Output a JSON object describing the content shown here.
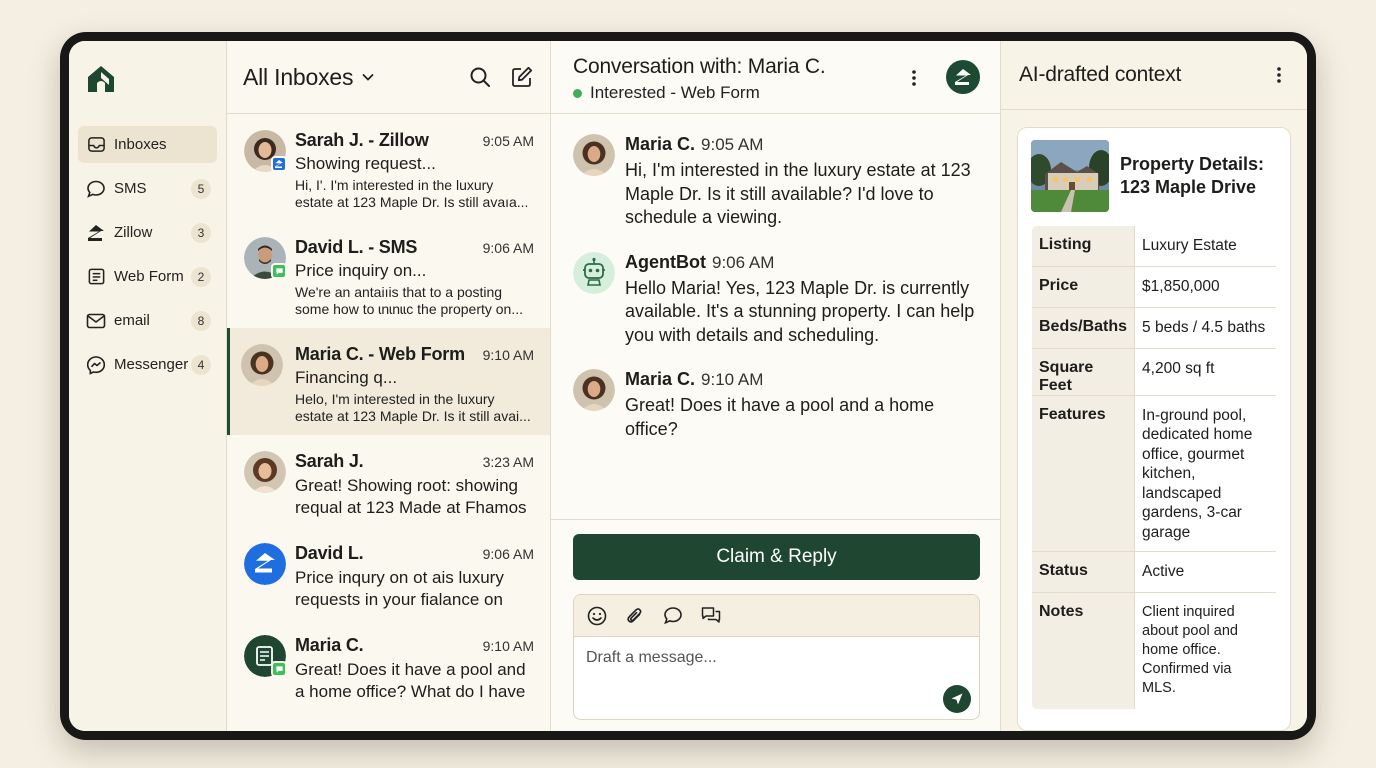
{
  "nav": {
    "items": [
      {
        "label": "Inboxes",
        "icon": "inbox-tray-icon",
        "count": null
      },
      {
        "label": "SMS",
        "icon": "chat-bubble-icon",
        "count": "5"
      },
      {
        "label": "Zillow",
        "icon": "zillow-icon",
        "count": "3"
      },
      {
        "label": "Web Form",
        "icon": "form-icon",
        "count": "2"
      },
      {
        "label": "email",
        "icon": "envelope-icon",
        "count": "8"
      },
      {
        "label": "Messenger",
        "icon": "messenger-icon",
        "count": "4"
      }
    ]
  },
  "inbox": {
    "title": "All Inboxes",
    "messages": [
      {
        "name": "Sarah J. - Zillow",
        "time": "9:05 AM",
        "subject": "Showing request...",
        "preview": "Hi, I'. I'm interested in the luxury estate at  123 Maple Dr. Is still avaıa..."
      },
      {
        "name": "David L. - SMS",
        "time": "9:06 AM",
        "subject": "Price inquiry on...",
        "preview": "We're an antaiıis that to a posting some how to ɩnɩnɩɩc the property on..."
      },
      {
        "name": "Maria C. - Web Form",
        "time": "9:10 AM",
        "subject": "Financing q...",
        "preview": "Helo, I'm interested in the luxury estate at 123 Maple Dr. Is it still avai..."
      },
      {
        "name": "Sarah J.",
        "time": "3:23 AM",
        "subject": "Great! Showing root: showing requal at 123 Made at Fhamos ..."
      },
      {
        "name": "David L.",
        "time": "9:06 AM",
        "subject": "Price inqury on ot ais luxury requests in your fialance on um..."
      },
      {
        "name": "Maria C.",
        "time": "9:10 AM",
        "subject": "Great! Does it have a pool and a home office? What do I have to..."
      }
    ]
  },
  "conversation": {
    "title": "Conversation with: Maria C.",
    "status": "Interested - Web Form",
    "messages": [
      {
        "name": "Maria C.",
        "time": "9:05 AM",
        "text": "Hi, I'm interested in the luxury estate at 123 Maple Dr. Is it still available? I'd love to schedule a viewing."
      },
      {
        "name": "AgentBot",
        "time": "9:06 AM",
        "text": "Hello Maria! Yes, 123 Maple Dr. is currently available. It's a stunning property. I can help you with details and scheduling."
      },
      {
        "name": "Maria C.",
        "time": "9:10 AM",
        "text": "Great! Does it have a pool and a home office?"
      }
    ],
    "claim_label": "Claim & Reply",
    "draft_placeholder": "Draft a message..."
  },
  "ai_panel": {
    "title": "AI-drafted context",
    "card_title_line1": "Property Details:",
    "card_title_line2": "123 Maple Drive",
    "rows": [
      {
        "key": "Listing",
        "value": "Luxury Estate"
      },
      {
        "key": "Price",
        "value": "$1,850,000"
      },
      {
        "key": "Beds/Baths",
        "value": "5 beds / 4.5 baths"
      },
      {
        "key": "Square Feet",
        "value": "4,200 sq ft"
      },
      {
        "key": "Features",
        "value": "In-ground pool, dedicated home office, gourmet kitchen, landscaped gardens, 3-car garage"
      },
      {
        "key": "Status",
        "value": "Active"
      },
      {
        "key": "Notes",
        "value": "Client inquired about pool and home office. Confirmed via MLS."
      }
    ]
  },
  "colors": {
    "brand": "#1e4630",
    "status_green": "#3fae5b",
    "zillow_blue": "#1f6ee0",
    "sms_green": "#3fbf5c"
  }
}
